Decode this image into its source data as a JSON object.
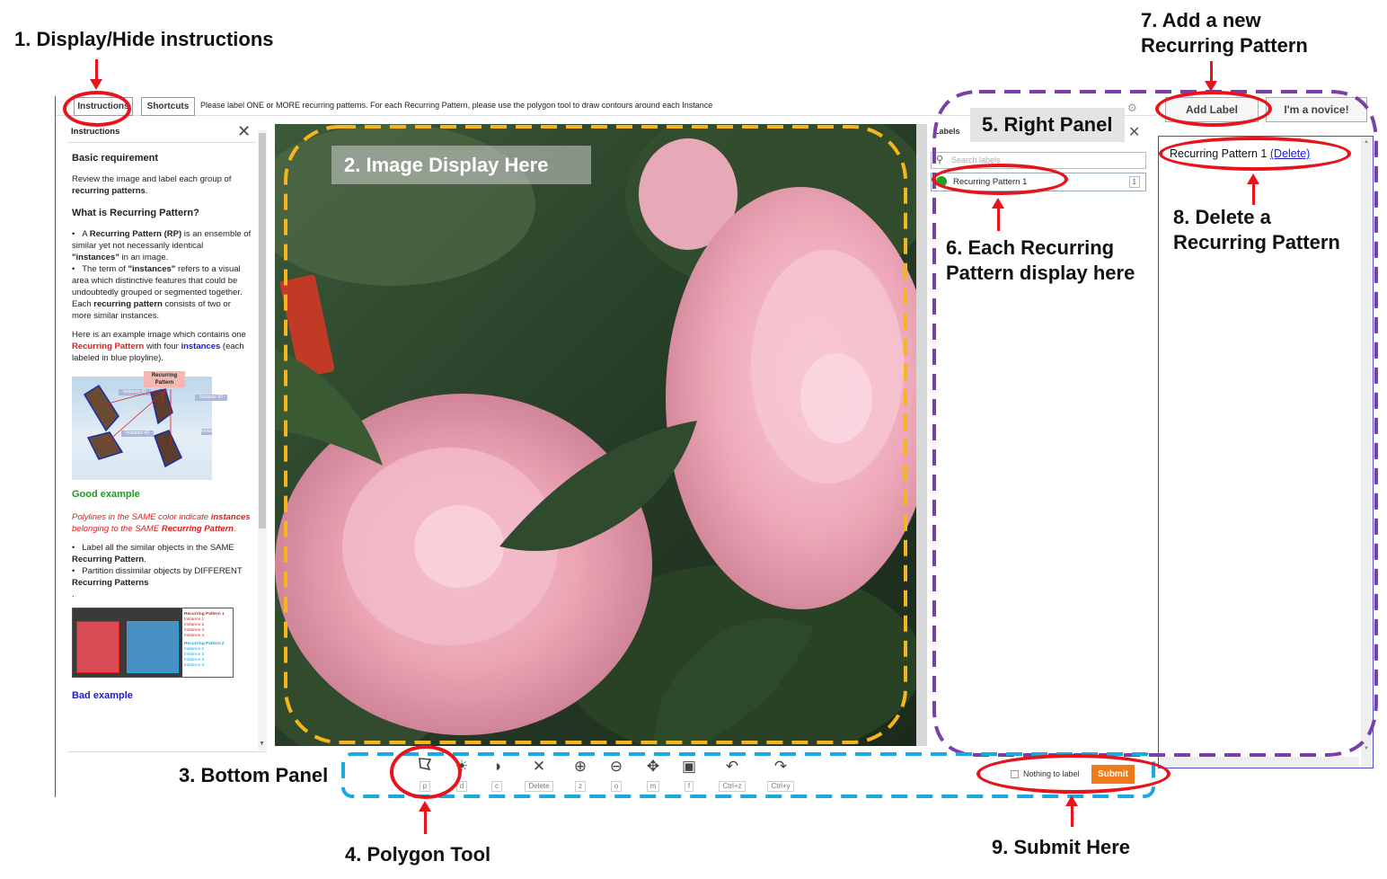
{
  "annotations": {
    "a1": "1. Display/Hide instructions",
    "a2": "2. Image Display Here",
    "a3": "3. Bottom Panel",
    "a4": "4. Polygon Tool",
    "a5": "5. Right Panel",
    "a6_line1": "6. Each Recurring",
    "a6_line2": "Pattern display here",
    "a7_line1": "7. Add a new",
    "a7_line2": "Recurring Pattern",
    "a8_line1": "8. Delete a",
    "a8_line2": "Recurring Pattern",
    "a9": "9. Submit Here"
  },
  "topbar": {
    "instructions_button": "Instructions",
    "shortcuts_button": "Shortcuts",
    "instruction_text": "Please label ONE or MORE recurring patterns. For each Recurring Pattern, please use the polygon tool to draw contours around each Instance"
  },
  "instructions": {
    "title": "Instructions",
    "basic_heading": "Basic requirement",
    "basic_text_1": "Review the image and label each group of ",
    "basic_text_bold": "recurring patterns",
    "basic_text_end": ".",
    "what_heading": "What is Recurring Pattern?",
    "bullet1_a": "A ",
    "bullet1_b": "Recurring Pattern (RP)",
    "bullet1_c": " is an ensemble of similar yet not necessarily identical ",
    "bullet1_d": "\"instances\"",
    "bullet1_e": " in an image.",
    "bullet2_a": "The term of ",
    "bullet2_b": "\"instances\"",
    "bullet2_c": " refers to a visual area which distinctive features that could be undoubtedly grouped or segmented together. Each ",
    "bullet2_d": "recurring pattern",
    "bullet2_e": " consists of two or more similar instances.",
    "example_a": "Here is an example image which contains one ",
    "example_b": "Recurring Pattern",
    "example_c": " with four ",
    "example_d": "instances",
    "example_e": " (each labeled in blue ployline).",
    "diagram_rp": "Recurring Pattern",
    "diagram_i1": "Instance #1",
    "diagram_i2": "Instance #2",
    "diagram_i3": "Instance #3",
    "diagram_i4": "Instance #4",
    "good_heading": "Good example",
    "good_note_a": "Polylines in the SAME color indicate ",
    "good_note_b": "instances",
    "good_note_c": " belonging to the SAME ",
    "good_note_d": "Recurring Pattern",
    "good_note_e": ".",
    "good_b1_a": "Label all the similar objects in the SAME ",
    "good_b1_b": "Recurring Pattern",
    "good_b1_c": ".",
    "good_b2_a": "Partition dissimilar objects by DIFFERENT ",
    "good_b2_b": "Recurring Patterns",
    "good_dot": ".",
    "legend_rp1": "Recurring Pattern 1",
    "legend_rp1_items": [
      "Instance 1",
      "Instance 2",
      "Instance 3",
      "Instance 4"
    ],
    "legend_rp2": "Recurring Pattern 2",
    "legend_rp2_items": [
      "Instance 1",
      "Instance 2",
      "Instance 3",
      "Instance 4"
    ],
    "bad_heading": "Bad example"
  },
  "labels_panel": {
    "tab": "Labels",
    "search_placeholder": "Search labels",
    "items": [
      {
        "label": "Recurring Pattern 1",
        "count": "1",
        "color": "#22a022"
      }
    ]
  },
  "right_panel": {
    "add_label": "Add Label",
    "novice": "I'm a novice!",
    "patterns": [
      {
        "label": "Recurring Pattern 1",
        "delete": "(Delete)"
      }
    ]
  },
  "toolbar": {
    "tools": [
      {
        "icon": "polygon-icon",
        "key": "p"
      },
      {
        "icon": "brightness-icon",
        "key": "d"
      },
      {
        "icon": "contrast-icon",
        "key": "c"
      },
      {
        "icon": "delete-icon",
        "key": "Delete"
      },
      {
        "icon": "zoom-in-icon",
        "key": "z"
      },
      {
        "icon": "zoom-out-icon",
        "key": "o"
      },
      {
        "icon": "move-icon",
        "key": "m"
      },
      {
        "icon": "fit-icon",
        "key": "f"
      },
      {
        "icon": "undo-icon",
        "key": "Ctrl+z"
      },
      {
        "icon": "redo-icon",
        "key": "Ctrl+y"
      }
    ],
    "nothing_to_label": "Nothing to label",
    "submit": "Submit"
  },
  "colors": {
    "callout_red": "#e8141b",
    "image_region_orange": "#f5b51b",
    "right_panel_purple": "#7a3fa8",
    "bottom_panel_blue": "#1aa8e0",
    "submit_orange": "#ee7a1a"
  }
}
